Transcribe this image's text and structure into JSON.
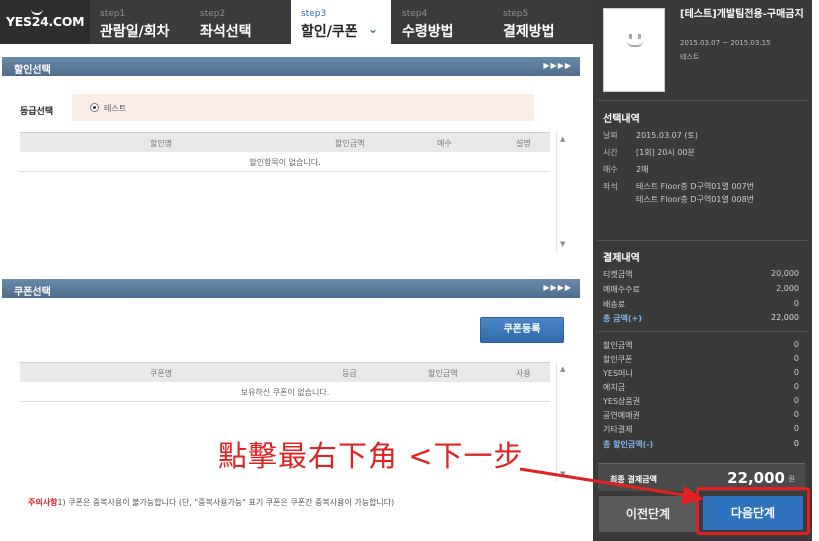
{
  "header": {
    "logo": "YES24.COM",
    "steps": [
      {
        "num": "step1",
        "name": "관람일/회차"
      },
      {
        "num": "step2",
        "name": "좌석선택"
      },
      {
        "num": "step3",
        "name": "할인/쿠폰"
      },
      {
        "num": "step4",
        "name": "수령방법"
      },
      {
        "num": "step5",
        "name": "결제방법"
      }
    ],
    "active_step": 3,
    "arrow_sections": "▶▶▶▶"
  },
  "discount": {
    "title": "할인선택",
    "grade_label": "등급선택",
    "grade_option": "테스트",
    "columns": [
      "할인명",
      "할인금액",
      "매수",
      "설명"
    ],
    "empty_text": "할인항목이 없습니다."
  },
  "coupon": {
    "title": "쿠폰선택",
    "register_button": "쿠폰등록",
    "columns": [
      "쿠폰명",
      "등급",
      "할인금액",
      "사용"
    ],
    "empty_text": "보유하신 쿠폰이 없습니다."
  },
  "annotation": {
    "text": "點擊最右下角 <下一步",
    "color": "#e02222"
  },
  "notice": {
    "head": "주의사항",
    "text": "1) 쿠폰은 중복사용이 불가능합니다 (단, \"중복사용가능\" 표기 쿠폰은 쿠폰간 중복사용이 가능합니다)"
  },
  "sidebar": {
    "show_title": "[테스트]개발팀전용-구매금지",
    "period": "2015.03.07 ~ 2015.03.15",
    "venue": "테스트",
    "poster_caption": "",
    "selection_title": "선택내역",
    "selection": [
      {
        "key": "날짜",
        "value": "2015.03.07 (토)"
      },
      {
        "key": "시간",
        "value": "[1회] 20시 00분"
      },
      {
        "key": "매수",
        "value": "2매"
      },
      {
        "key": "좌석",
        "value": "테스트 Floor층 D구역01열 007번"
      },
      {
        "key": "",
        "value": "테스트 Floor층 D구역01열 008번"
      }
    ],
    "payment_title": "결제내역",
    "payment": [
      {
        "key": "티켓금액",
        "value": "20,000"
      },
      {
        "key": "예매수수료",
        "value": "2,000"
      },
      {
        "key": "배송료",
        "value": "0"
      },
      {
        "key": "총 금액(+)",
        "value": "22,000"
      }
    ],
    "discounts": [
      {
        "key": "할인금액",
        "value": "0"
      },
      {
        "key": "할인쿠폰",
        "value": "0"
      },
      {
        "key": "YES머니",
        "value": "0"
      },
      {
        "key": "예치금",
        "value": "0"
      },
      {
        "key": "YES상품권",
        "value": "0"
      },
      {
        "key": "공연예매권",
        "value": "0"
      },
      {
        "key": "기타결제",
        "value": "0"
      },
      {
        "key": "총 할인금액(-)",
        "value": "0"
      }
    ],
    "final_label": "최종 결제금액",
    "final_amount": "22,000",
    "final_unit": "원",
    "prev_button": "이전단계",
    "next_button": "다음단계"
  }
}
